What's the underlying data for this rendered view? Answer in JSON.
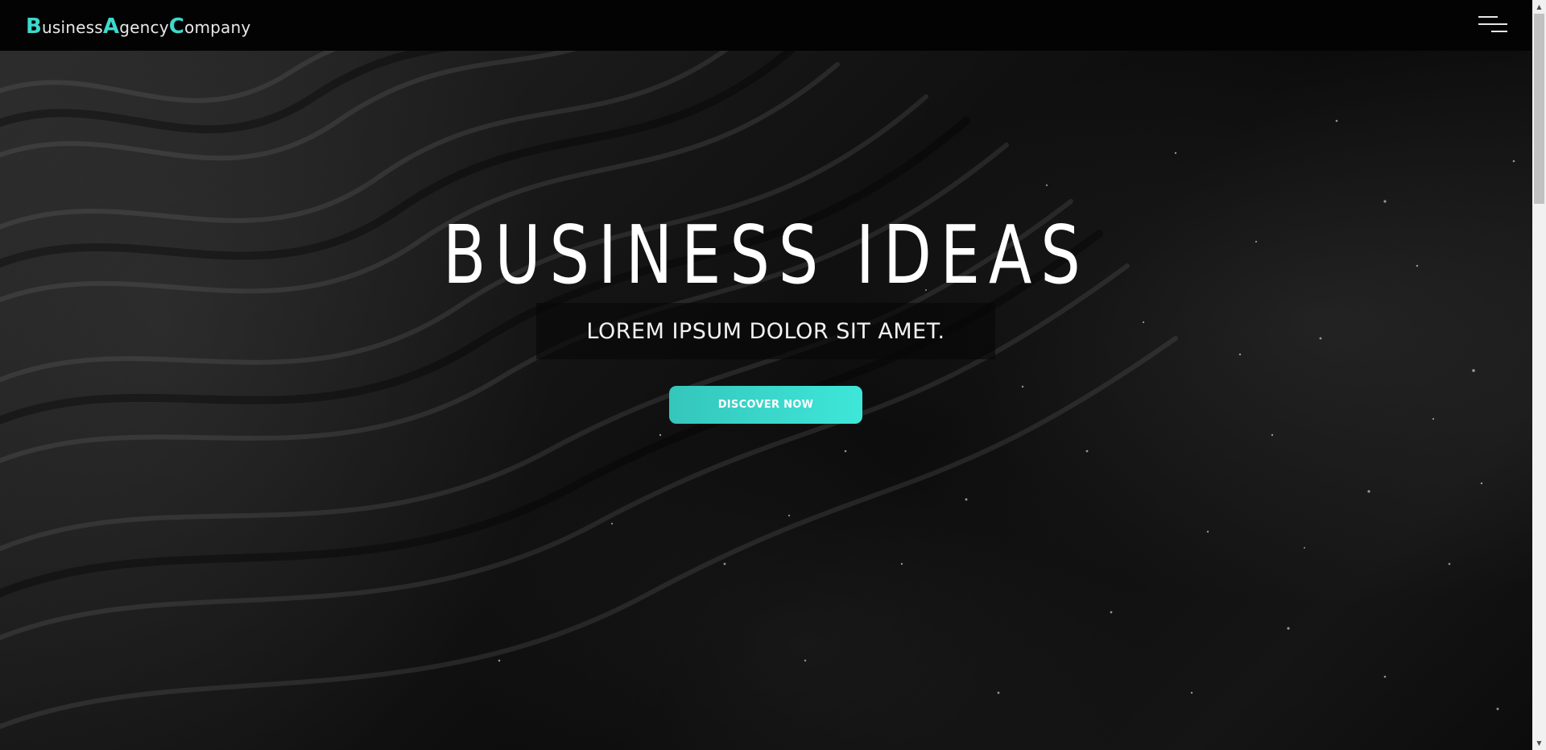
{
  "header": {
    "logo": [
      {
        "cap": "B",
        "rest": "usiness"
      },
      {
        "cap": "A",
        "rest": "gency"
      },
      {
        "cap": "C",
        "rest": "ompany"
      }
    ],
    "menu_icon": "hamburger-menu-icon"
  },
  "hero": {
    "title": "BUSINESS IDEAS",
    "subtitle": "LOREM IPSUM DOLOR SIT AMET.",
    "cta_label": "DISCOVER NOW"
  },
  "colors": {
    "accent": "#3dd9cc",
    "header_bg": "#030303",
    "text": "#ffffff"
  },
  "scrollbar": {
    "up_icon": "scroll-up-arrow-icon",
    "down_icon": "scroll-down-arrow-icon"
  }
}
